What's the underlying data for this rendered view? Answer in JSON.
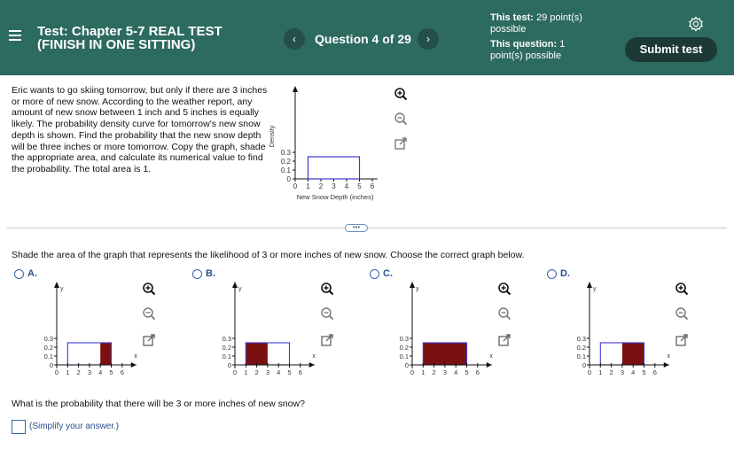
{
  "header": {
    "title_line1": "Test:  Chapter 5-7 REAL TEST",
    "title_line2": "(FINISH IN ONE SITTING)",
    "prev_label": "‹",
    "next_label": "›",
    "question_label": "Question 4 of 29",
    "this_test_label": "This test:",
    "this_test_value": "29 point(s)",
    "this_test_value2": "possible",
    "this_question_label": "This question:",
    "this_question_value": "1",
    "this_question_value2": "point(s) possible",
    "submit_label": "Submit test"
  },
  "question": {
    "prompt": "Eric wants to go skiing tomorrow, but only if there are 3 inches or more of new snow. According to the weather report, any amount of new snow between 1 inch and 5 inches is equally likely. The probability density curve for tomorrow's new snow depth is shown. Find the probability that the new snow depth will be three inches or more tomorrow. Copy the graph, shade the appropriate area, and calculate its numerical value to find the probability. The total area is 1.",
    "graph": {
      "ylabel": "Density",
      "xlabel": "New Snow Depth (inches)",
      "yticks": [
        "0",
        "0.1",
        "0.2",
        "0.3"
      ],
      "xticks": [
        "0",
        "1",
        "2",
        "3",
        "4",
        "5",
        "6"
      ]
    },
    "expand_dots": "•••",
    "instruction": "Shade the area of the graph that represents the likelihood of 3 or more inches of new snow. Choose the correct graph below.",
    "options": [
      {
        "letter": "A.",
        "shade": [
          4,
          5
        ]
      },
      {
        "letter": "B.",
        "shade": [
          1,
          3
        ]
      },
      {
        "letter": "C.",
        "shade": [
          1,
          5
        ]
      },
      {
        "letter": "D.",
        "shade": [
          3,
          5
        ]
      }
    ],
    "option_graph": {
      "yticks": [
        "0",
        "0.1",
        "0.2",
        "0.3"
      ],
      "xticks": [
        "0",
        "1",
        "2",
        "3",
        "4",
        "5",
        "6"
      ],
      "x_axis_label": "x",
      "y_axis_label": "y"
    },
    "question2": "What is the probability that there will be 3 or more inches of new snow?",
    "answer_hint": "(Simplify your answer.)"
  },
  "chart_data": {
    "type": "area",
    "x": [
      1,
      5
    ],
    "y": [
      0.25,
      0.25
    ],
    "xlabel": "New Snow Depth (inches)",
    "ylabel": "Density",
    "xlim": [
      0,
      6
    ],
    "ylim": [
      0,
      0.3
    ]
  },
  "colors": {
    "header_bg": "#2d6a5f",
    "shade": "#7a1010",
    "outline": "#3a3ad0",
    "link": "#2c4f8a"
  }
}
